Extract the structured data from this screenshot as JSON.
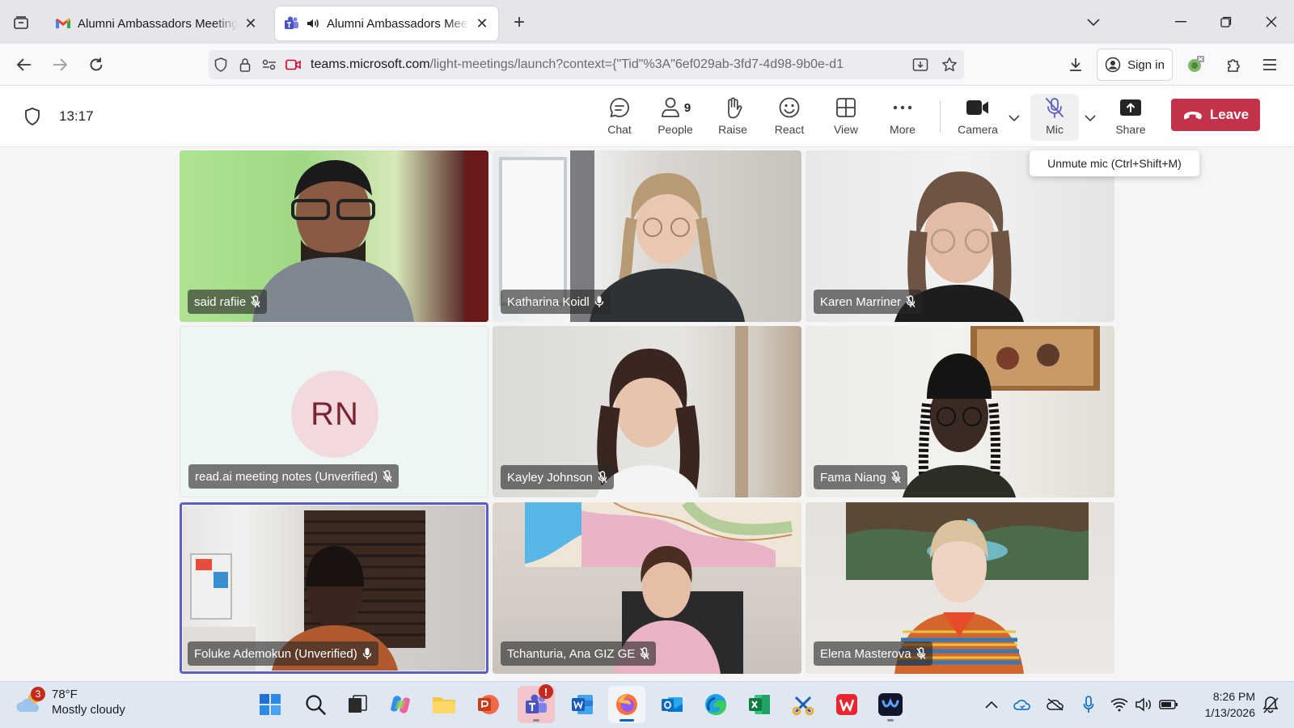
{
  "browser": {
    "tabs": [
      {
        "title": "Alumni Ambassadors Meeting - ",
        "active": false,
        "icon": "gmail-icon"
      },
      {
        "title": "Alumni Ambassadors Meeting | ",
        "active": true,
        "icon": "teams-icon"
      }
    ],
    "url_host": "teams.microsoft.com",
    "url_path": "/light-meetings/launch?context={\"Tid\"%3A\"6ef029ab-3fd7-4d98-9b0e-d1",
    "signin_label": "Sign in"
  },
  "meeting": {
    "elapsed": "13:17",
    "toolbar": {
      "chat": "Chat",
      "people": "People",
      "people_count": "9",
      "raise": "Raise",
      "react": "React",
      "view": "View",
      "more": "More",
      "camera": "Camera",
      "mic": "Mic",
      "share": "Share",
      "leave": "Leave"
    },
    "mic_tooltip": "Unmute mic (Ctrl+Shift+M)",
    "participants": [
      {
        "name": "said rafiie",
        "mic": "muted"
      },
      {
        "name": "Katharina Koidl",
        "mic": "on"
      },
      {
        "name": "Karen Marriner",
        "mic": "muted"
      },
      {
        "name": "read.ai meeting notes (Unverified)",
        "mic": "muted",
        "initials": "RN"
      },
      {
        "name": "Kayley Johnson",
        "mic": "muted"
      },
      {
        "name": "Fama Niang",
        "mic": "muted"
      },
      {
        "name": "Foluke Ademokun (Unverified)",
        "mic": "on",
        "speaking": true
      },
      {
        "name": "Tchanturia, Ana GIZ GE",
        "mic": "muted"
      },
      {
        "name": "Elena Masterova",
        "mic": "muted"
      }
    ]
  },
  "taskbar": {
    "weather_temp": "78°F",
    "weather_desc": "Mostly cloudy",
    "weather_badge": "3",
    "time": "8:26 PM",
    "date": "1/13/2026"
  },
  "colors": {
    "teams_accent": "#5b5fc7",
    "leave_red": "#c4314b"
  }
}
